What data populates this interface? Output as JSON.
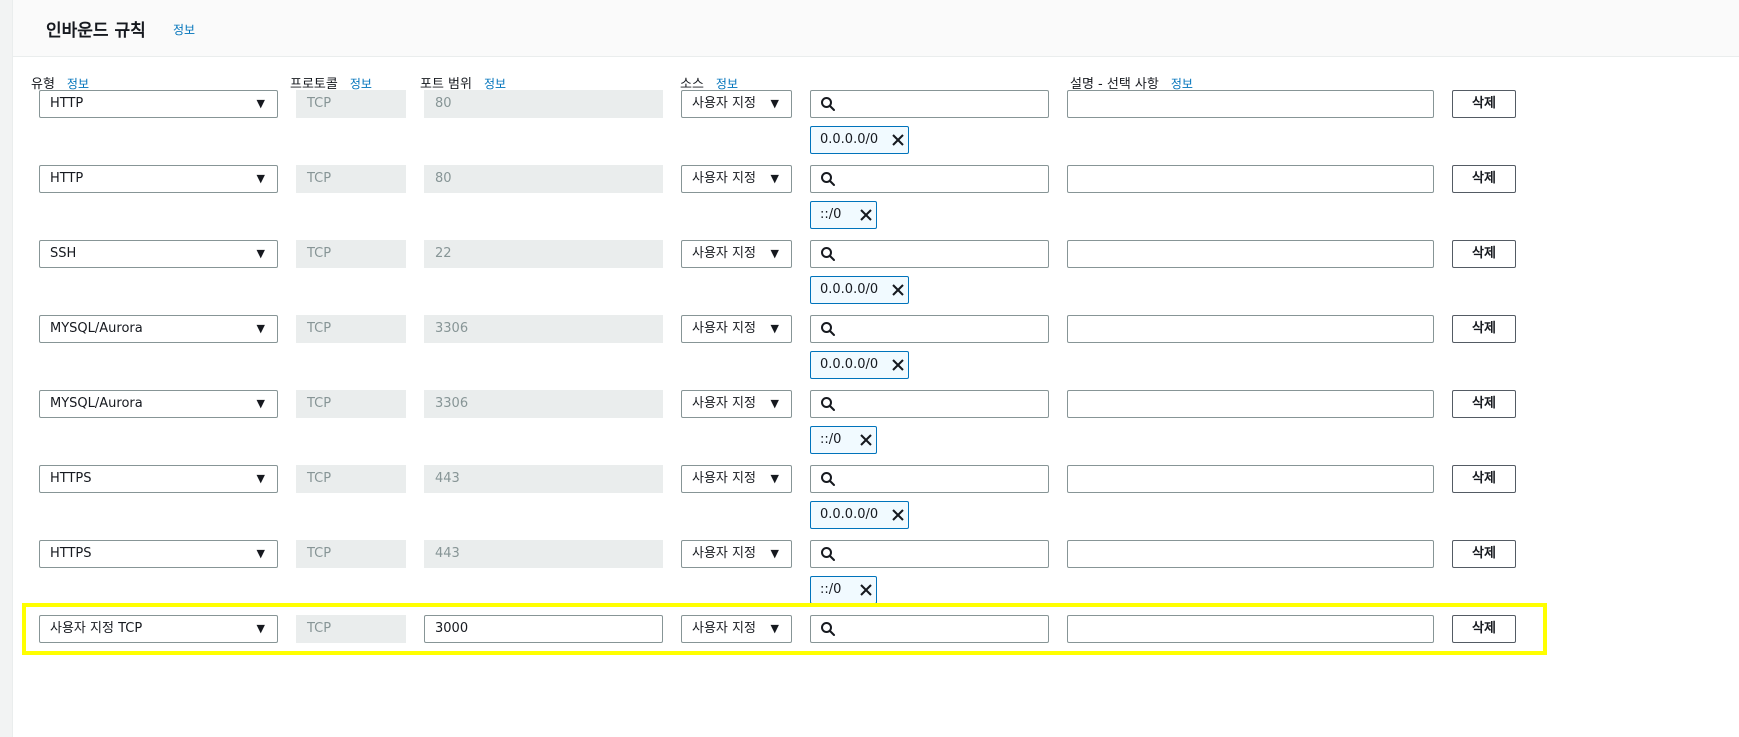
{
  "section": {
    "title": "인바운드 규칙",
    "info": "정보"
  },
  "columns": {
    "type": "유형",
    "protocol": "프로토콜",
    "port_range": "포트 범위",
    "source": "소스",
    "description": "설명 - 선택 사항",
    "info": "정보"
  },
  "rules": [
    {
      "type": "HTTP",
      "protocol": "TCP",
      "port": "80",
      "source_type": "사용자 지정",
      "search_placeholder": "",
      "cidr": "0.0.0.0/0",
      "description": "",
      "delete_label": "삭제"
    },
    {
      "type": "HTTP",
      "protocol": "TCP",
      "port": "80",
      "source_type": "사용자 지정",
      "search_placeholder": "",
      "cidr": "::/0",
      "description": "",
      "delete_label": "삭제"
    },
    {
      "type": "SSH",
      "protocol": "TCP",
      "port": "22",
      "source_type": "사용자 지정",
      "search_placeholder": "",
      "cidr": "0.0.0.0/0",
      "description": "",
      "delete_label": "삭제"
    },
    {
      "type": "MYSQL/Aurora",
      "protocol": "TCP",
      "port": "3306",
      "source_type": "사용자 지정",
      "search_placeholder": "",
      "cidr": "0.0.0.0/0",
      "description": "",
      "delete_label": "삭제"
    },
    {
      "type": "MYSQL/Aurora",
      "protocol": "TCP",
      "port": "3306",
      "source_type": "사용자 지정",
      "search_placeholder": "",
      "cidr": "::/0",
      "description": "",
      "delete_label": "삭제"
    },
    {
      "type": "HTTPS",
      "protocol": "TCP",
      "port": "443",
      "source_type": "사용자 지정",
      "search_placeholder": "",
      "cidr": "0.0.0.0/0",
      "description": "",
      "delete_label": "삭제"
    },
    {
      "type": "HTTPS",
      "protocol": "TCP",
      "port": "443",
      "source_type": "사용자 지정",
      "search_placeholder": "",
      "cidr": "::/0",
      "description": "",
      "delete_label": "삭제"
    },
    {
      "type": "사용자 지정 TCP",
      "protocol": "TCP",
      "port": "3000",
      "source_type": "사용자 지정",
      "search_placeholder": "",
      "cidr": null,
      "description": "",
      "delete_label": "삭제",
      "port_editable": true,
      "highlighted": true
    }
  ],
  "colors": {
    "link": "#0073bb",
    "highlight": "#ffff00",
    "disabled_bg": "#eaeded",
    "token_border": "#0073bb"
  },
  "icons": {
    "dropdown": "caret-down-icon",
    "search": "search-icon",
    "remove": "close-icon"
  }
}
